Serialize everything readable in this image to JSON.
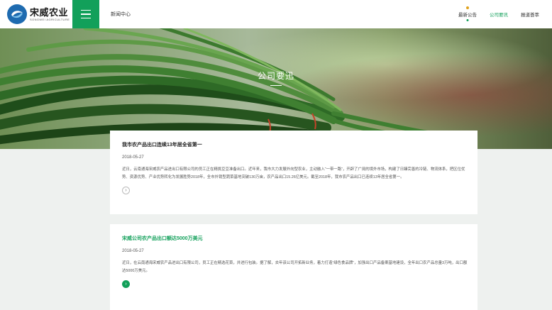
{
  "logo": {
    "name": "宋威农业",
    "en": "SONGWEI AGRICULTURE"
  },
  "header": {
    "breadcrumb": "新闻中心"
  },
  "nav": [
    {
      "label": "最新公告",
      "active": false
    },
    {
      "label": "公司要讯",
      "active": true
    },
    {
      "label": "报道荟萃",
      "active": false
    }
  ],
  "banner": {
    "title": "公司要迅"
  },
  "articles": [
    {
      "title": "我市农产品出口连续13年居全省第一",
      "date": "2018-05-27",
      "body": "近日，云南通海宋威农产品进出口有限公司的员工正在精挑豆豆准备出口。近年来，我市大力发展外向型农业，主动融入“一带一路”，开辟了广阔的境外市场，构建了日臻完善的冷链、物流体系，把区位优势、资源优势、产业优势转化为发展胜势2018年，全市外销型蔬菜基地突破130万亩，农产品出口15.26亿美元。截至2018年，我市农产品出口已连续13年居全省第一。"
    },
    {
      "title": "宋威公司农产品出口额达5000万美元",
      "date": "2018-05-27",
      "body": "近日，在云南通海宋威农产品进出口有限公司，员工正在精选花菜，并进行包装。据了解，去年该公司开拓新业务，着力打造“绿色食品牌”，加强出口产品备案基地建设，全年出口农产品总量3万吨，出口额达5000万美元。"
    }
  ],
  "colors": {
    "accent": "#12a05a",
    "brand": "#1e6bb0"
  }
}
